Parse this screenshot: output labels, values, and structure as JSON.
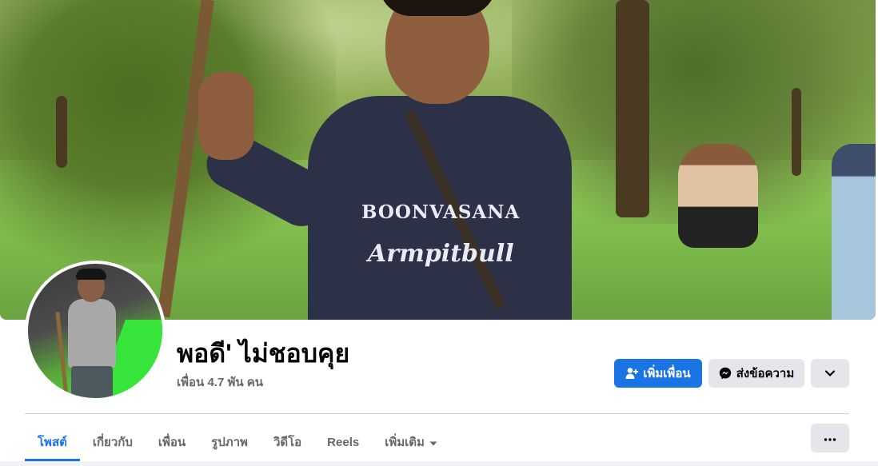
{
  "profile": {
    "name": "พอดี' ไม่ชอบคุย",
    "friends_count": "เพื่อน 4.7 พัน คน"
  },
  "cover": {
    "shirt_text": "BOONVASANA",
    "shirt_script": "Armpitbull"
  },
  "actions": {
    "add_friend_label": "เพิ่มเพื่อน",
    "message_label": "ส่งข้อความ",
    "more_icon": "chevron-down-icon"
  },
  "tabs": [
    {
      "label": "โพสต์",
      "active": true
    },
    {
      "label": "เกี่ยวกับ",
      "active": false
    },
    {
      "label": "เพื่อน",
      "active": false
    },
    {
      "label": "รูปภาพ",
      "active": false
    },
    {
      "label": "วิดีโอ",
      "active": false
    },
    {
      "label": "Reels",
      "active": false
    },
    {
      "label": "เพิ่มเติม",
      "active": false,
      "icon": "caret-down-icon"
    }
  ],
  "tab_overflow_icon": "ellipsis-icon",
  "colors": {
    "accent": "#1b74e4",
    "secondary_button": "#e4e6eb",
    "muted_text": "#65676b",
    "divider": "#ced0d4"
  }
}
